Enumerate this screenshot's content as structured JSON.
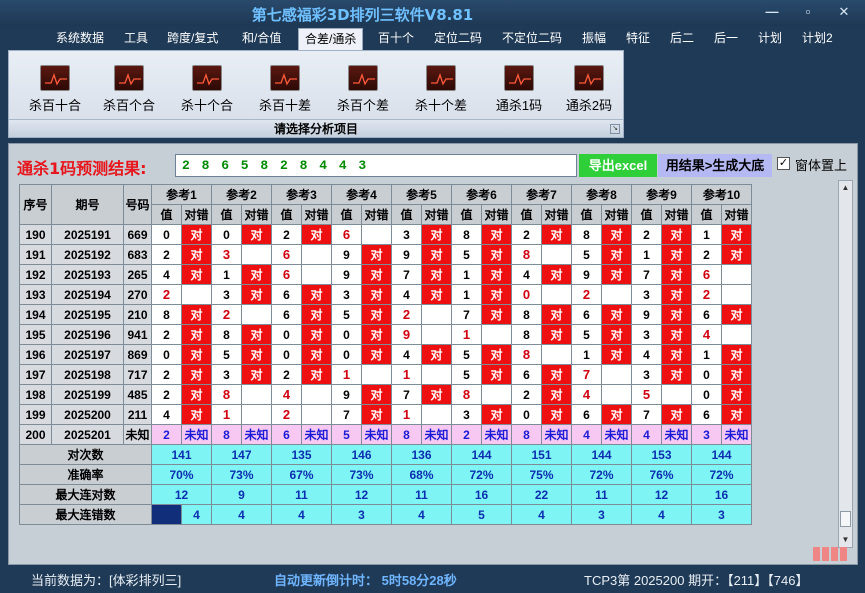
{
  "window": {
    "title": "第七感福彩3D排列三软件V8.81",
    "minimize": "—",
    "maximize": "▫",
    "close": "✕"
  },
  "menu": [
    "系统数据",
    "工具",
    "跨度/复式",
    "和/合值",
    "合差/通杀",
    "百十个",
    "定位二码",
    "不定位二码",
    "振幅",
    "特征",
    "后二",
    "后一",
    "计划",
    "计划2"
  ],
  "menu_active": "合差/通杀",
  "ribbon": {
    "buttons": [
      "杀百十合",
      "杀百个合",
      "杀十个合",
      "杀百十差",
      "杀百个差",
      "杀十个差",
      "通杀1码",
      "通杀2码"
    ],
    "icon": "chart-icon",
    "footer": "请选择分析项目"
  },
  "prediction": {
    "label": "通杀1码预测结果:",
    "value": "2 8 6 5 8 2 8 4 4 3"
  },
  "actions": {
    "excel": "导出excel",
    "generate": "用结果>生成大底",
    "topmost_checked": "✓",
    "topmost_label": "窗体置上"
  },
  "grid": {
    "headers": {
      "seq": "序号",
      "period": "期号",
      "number": "号码"
    },
    "refs": [
      "参考1",
      "参考2",
      "参考3",
      "参考4",
      "参考5",
      "参考6",
      "参考7",
      "参考8",
      "参考9",
      "参考10"
    ],
    "sub_headers": {
      "value": "值",
      "check": "对错"
    },
    "hit_label": "对",
    "rows": [
      {
        "seq": "190",
        "period": "2025191",
        "number": "669",
        "cells": [
          [
            "0",
            true
          ],
          [
            "0",
            true
          ],
          [
            "2",
            true
          ],
          [
            "6",
            false
          ],
          [
            "3",
            true
          ],
          [
            "8",
            true
          ],
          [
            "2",
            true
          ],
          [
            "8",
            true
          ],
          [
            "2",
            true
          ],
          [
            "1",
            true
          ]
        ]
      },
      {
        "seq": "191",
        "period": "2025192",
        "number": "683",
        "cells": [
          [
            "2",
            true
          ],
          [
            "3",
            false
          ],
          [
            "6",
            false
          ],
          [
            "9",
            true
          ],
          [
            "9",
            true
          ],
          [
            "5",
            true
          ],
          [
            "8",
            false
          ],
          [
            "5",
            true
          ],
          [
            "1",
            true
          ],
          [
            "2",
            true
          ]
        ]
      },
      {
        "seq": "192",
        "period": "2025193",
        "number": "265",
        "cells": [
          [
            "4",
            true
          ],
          [
            "1",
            true
          ],
          [
            "6",
            false
          ],
          [
            "9",
            true
          ],
          [
            "7",
            true
          ],
          [
            "1",
            true
          ],
          [
            "4",
            true
          ],
          [
            "9",
            true
          ],
          [
            "7",
            true
          ],
          [
            "6",
            false
          ]
        ]
      },
      {
        "seq": "193",
        "period": "2025194",
        "number": "270",
        "cells": [
          [
            "2",
            false
          ],
          [
            "3",
            true
          ],
          [
            "6",
            true
          ],
          [
            "3",
            true
          ],
          [
            "4",
            true
          ],
          [
            "1",
            true
          ],
          [
            "0",
            false
          ],
          [
            "2",
            false
          ],
          [
            "3",
            true
          ],
          [
            "2",
            false
          ]
        ]
      },
      {
        "seq": "194",
        "period": "2025195",
        "number": "210",
        "cells": [
          [
            "8",
            true
          ],
          [
            "2",
            false
          ],
          [
            "6",
            true
          ],
          [
            "5",
            true
          ],
          [
            "2",
            false
          ],
          [
            "7",
            true
          ],
          [
            "8",
            true
          ],
          [
            "6",
            true
          ],
          [
            "9",
            true
          ],
          [
            "6",
            true
          ]
        ]
      },
      {
        "seq": "195",
        "period": "2025196",
        "number": "941",
        "cells": [
          [
            "2",
            true
          ],
          [
            "8",
            true
          ],
          [
            "0",
            true
          ],
          [
            "0",
            true
          ],
          [
            "9",
            false
          ],
          [
            "1",
            false
          ],
          [
            "8",
            true
          ],
          [
            "5",
            true
          ],
          [
            "3",
            true
          ],
          [
            "4",
            false
          ]
        ]
      },
      {
        "seq": "196",
        "period": "2025197",
        "number": "869",
        "cells": [
          [
            "0",
            true
          ],
          [
            "5",
            true
          ],
          [
            "0",
            true
          ],
          [
            "0",
            true
          ],
          [
            "4",
            true
          ],
          [
            "5",
            true
          ],
          [
            "8",
            false
          ],
          [
            "1",
            true
          ],
          [
            "4",
            true
          ],
          [
            "1",
            true
          ]
        ]
      },
      {
        "seq": "197",
        "period": "2025198",
        "number": "717",
        "cells": [
          [
            "2",
            true
          ],
          [
            "3",
            true
          ],
          [
            "2",
            true
          ],
          [
            "1",
            false
          ],
          [
            "1",
            false
          ],
          [
            "5",
            true
          ],
          [
            "6",
            true
          ],
          [
            "7",
            false
          ],
          [
            "3",
            true
          ],
          [
            "0",
            true
          ]
        ]
      },
      {
        "seq": "198",
        "period": "2025199",
        "number": "485",
        "cells": [
          [
            "2",
            true
          ],
          [
            "8",
            false
          ],
          [
            "4",
            false
          ],
          [
            "9",
            true
          ],
          [
            "7",
            true
          ],
          [
            "8",
            false
          ],
          [
            "2",
            true
          ],
          [
            "4",
            false
          ],
          [
            "5",
            false
          ],
          [
            "0",
            true
          ]
        ]
      },
      {
        "seq": "199",
        "period": "2025200",
        "number": "211",
        "cells": [
          [
            "4",
            true
          ],
          [
            "1",
            false
          ],
          [
            "2",
            false
          ],
          [
            "7",
            true
          ],
          [
            "1",
            false
          ],
          [
            "3",
            true
          ],
          [
            "0",
            true
          ],
          [
            "6",
            true
          ],
          [
            "7",
            true
          ],
          [
            "6",
            true
          ]
        ]
      }
    ],
    "pending": {
      "seq": "200",
      "period": "2025201",
      "number": "未知",
      "values": [
        "2",
        "8",
        "6",
        "5",
        "8",
        "2",
        "8",
        "4",
        "4",
        "3"
      ],
      "unknown_label": "未知"
    },
    "stats": [
      {
        "label": "对次数",
        "values": [
          "141",
          "147",
          "135",
          "146",
          "136",
          "144",
          "151",
          "144",
          "153",
          "144"
        ]
      },
      {
        "label": "准确率",
        "values": [
          "70%",
          "73%",
          "67%",
          "73%",
          "68%",
          "72%",
          "75%",
          "72%",
          "76%",
          "72%"
        ]
      },
      {
        "label": "最大连对数",
        "values": [
          "12",
          "9",
          "11",
          "12",
          "11",
          "16",
          "22",
          "11",
          "12",
          "16"
        ]
      },
      {
        "label": "最大连错数",
        "values": [
          "4",
          "4",
          "4",
          "3",
          "4",
          "5",
          "4",
          "3",
          "4",
          "3"
        ]
      }
    ]
  },
  "status": {
    "source": "当前数据为：[体彩排列三]",
    "countdown": "自动更新倒计时： 5时58分28秒",
    "draw": "TCP3第 2025200 期开：【211】【746】"
  },
  "colors": {
    "hit": "#ee1010",
    "miss_text": "#d00010",
    "stat_bg": "#7ff4f4",
    "pending_bg": "#f7c8f2"
  }
}
